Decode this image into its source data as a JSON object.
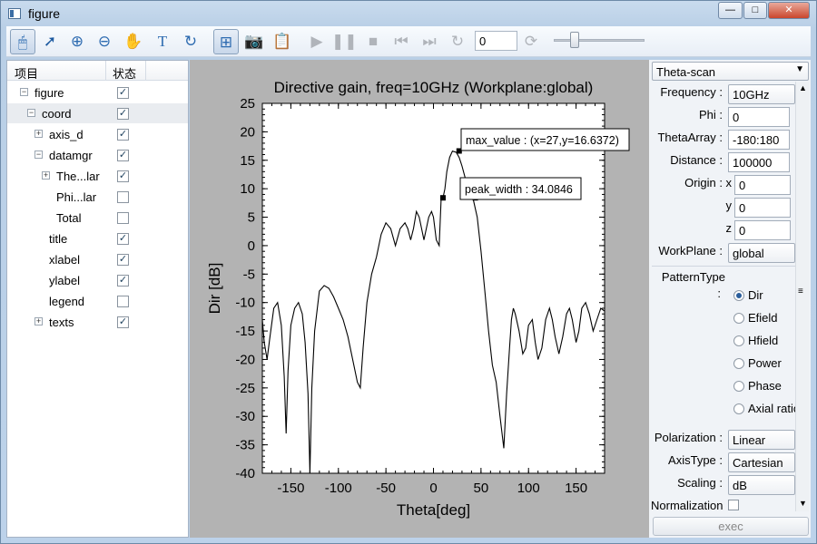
{
  "window": {
    "title": "figure",
    "minimize": "—",
    "maximize": "□",
    "close": "✕"
  },
  "toolbar": {
    "icons": [
      "mouse-icon",
      "pointer-icon",
      "zoom-in-icon",
      "zoom-out-icon",
      "pan-hand-icon",
      "text-icon",
      "rotate-icon",
      "data-cursor-icon",
      "camera-icon",
      "camera-clip-icon",
      "play-icon",
      "pause-icon",
      "stop-icon",
      "skip-back-icon",
      "skip-forward-icon",
      "refresh-icon"
    ],
    "frame_value": "0"
  },
  "tree": {
    "col_name": "项目",
    "col_state": "状态",
    "rows": [
      {
        "label": "figure",
        "checked": true,
        "expander": "−"
      },
      {
        "label": "coord",
        "checked": true,
        "expander": "−"
      },
      {
        "label": "axis_d",
        "checked": true,
        "expander": "+"
      },
      {
        "label": "datamgr",
        "checked": true,
        "expander": "−"
      },
      {
        "label": "The...lar",
        "checked": true,
        "expander": "+"
      },
      {
        "label": "Phi...lar",
        "checked": false,
        "expander": ""
      },
      {
        "label": "Total",
        "checked": false,
        "expander": ""
      },
      {
        "label": "title",
        "checked": true,
        "expander": ""
      },
      {
        "label": "xlabel",
        "checked": true,
        "expander": ""
      },
      {
        "label": "ylabel",
        "checked": true,
        "expander": ""
      },
      {
        "label": "legend",
        "checked": false,
        "expander": ""
      },
      {
        "label": "texts",
        "checked": true,
        "expander": "+"
      }
    ]
  },
  "chart_data": {
    "type": "line",
    "title": "Directive gain, freq=10GHz (Workplane:global)",
    "xlabel": "Theta[deg]",
    "ylabel": "Dir [dB]",
    "xlim": [
      -180,
      180
    ],
    "ylim": [
      -40,
      25
    ],
    "xticks": [
      -150,
      -100,
      -50,
      0,
      50,
      100,
      150
    ],
    "yticks": [
      25,
      20,
      15,
      10,
      5,
      0,
      -5,
      -10,
      -15,
      -20,
      -25,
      -30,
      -35,
      -40
    ],
    "series": [
      {
        "x": [
          -180,
          -178,
          -175,
          -172,
          -168,
          -164,
          -160,
          -157,
          -155,
          -153,
          -150,
          -146,
          -142,
          -138,
          -135,
          -132,
          -130,
          -128,
          -125,
          -120,
          -115,
          -110,
          -105,
          -100,
          -95,
          -90,
          -85,
          -80,
          -77,
          -74,
          -70,
          -65,
          -60,
          -55,
          -50,
          -45,
          -40,
          -35,
          -30,
          -27,
          -24,
          -21,
          -18,
          -15,
          -10,
          -5,
          -2,
          0,
          3,
          6,
          8,
          10,
          12,
          14,
          17,
          20,
          24,
          27,
          30,
          34,
          38,
          42,
          46,
          50,
          54,
          58,
          62,
          66,
          70,
          74,
          77,
          80,
          82,
          84,
          86,
          90,
          94,
          97,
          100,
          104,
          107,
          110,
          114,
          118,
          122,
          125,
          128,
          132,
          136,
          140,
          143,
          146,
          150,
          153,
          156,
          160,
          164,
          168,
          172,
          176,
          180
        ],
        "y": [
          -13,
          -17,
          -20,
          -16,
          -11,
          -10,
          -14,
          -23,
          -33,
          -22,
          -14,
          -11,
          -10,
          -12,
          -17,
          -26,
          -40,
          -25,
          -15,
          -8,
          -7,
          -7.5,
          -9,
          -11,
          -13,
          -16,
          -20,
          -24,
          -25,
          -18,
          -10,
          -5,
          -2,
          2,
          4,
          3,
          0,
          3,
          4,
          3,
          1,
          3,
          6,
          5,
          1,
          5,
          6,
          5,
          1,
          0,
          8,
          8.4,
          10,
          13,
          15.5,
          16.6,
          16.4,
          15.5,
          14,
          11.5,
          10,
          8,
          5,
          -1,
          -8,
          -15,
          -21,
          -24,
          -30,
          -35.6,
          -26,
          -18,
          -13,
          -11,
          -12,
          -15,
          -19,
          -18,
          -14,
          -13,
          -17,
          -20,
          -18,
          -13,
          -11,
          -13,
          -16,
          -19,
          -16,
          -12,
          -11,
          -13,
          -17,
          -15,
          -11,
          -10,
          -12,
          -15,
          -13,
          -11,
          -11.5
        ]
      }
    ],
    "annotations": [
      {
        "text": "max_value : (x=27,y=16.6372)",
        "x": 27,
        "y": 16.6372
      },
      {
        "text": "peak_width : 34.0846",
        "x1": 10,
        "y1": 8.4,
        "x2": 44,
        "y2": 8.4
      }
    ]
  },
  "panel": {
    "scan_type": "Theta-scan",
    "frequency_label": "Frequency :",
    "frequency_value": "10GHz",
    "phi_label": "Phi :",
    "phi_value": "0",
    "theta_label": "ThetaArray :",
    "theta_value": "-180:180",
    "distance_label": "Distance :",
    "distance_value": "100000",
    "origin_label": "Origin :",
    "origin_x_label": "x",
    "origin_x": "0",
    "origin_y_label": "y",
    "origin_y": "0",
    "origin_z_label": "z",
    "origin_z": "0",
    "workplane_label": "WorkPlane :",
    "workplane_value": "global",
    "pattern_label": "PatternType",
    "pattern_colon": ":",
    "pattern_options": [
      "Dir",
      "Efield",
      "Hfield",
      "Power",
      "Phase",
      "Axial ratio"
    ],
    "pattern_selected": "Dir",
    "polarization_label": "Polarization :",
    "polarization_value": "Linear",
    "axistype_label": "AxisType :",
    "axistype_value": "Cartesian",
    "scaling_label": "Scaling :",
    "scaling_value": "dB",
    "normalization_label": "Normalization",
    "exec_label": "exec"
  }
}
